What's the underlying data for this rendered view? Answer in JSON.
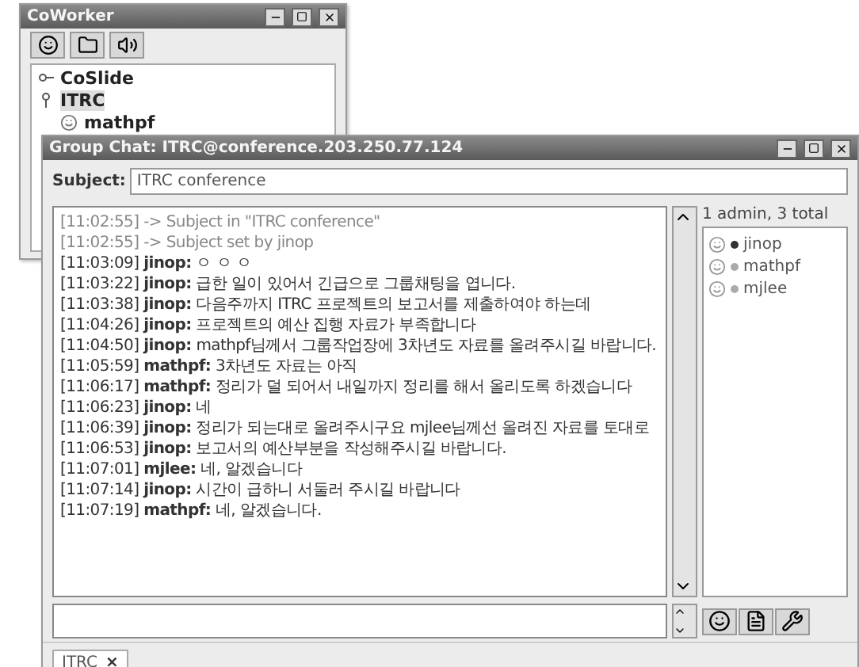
{
  "back_window": {
    "title": "CoWorker",
    "tree": [
      {
        "label": "CoSlide",
        "expanded": false,
        "selected": false
      },
      {
        "label": "ITRC",
        "expanded": true,
        "selected": true,
        "children": [
          {
            "label": "mathpf",
            "selected": false
          }
        ]
      }
    ]
  },
  "chat_window": {
    "title": "Group Chat: ITRC@conference.203.250.77.124",
    "subject_label": "Subject:",
    "subject": "ITRC conference",
    "messages": [
      {
        "kind": "system",
        "time": "[11:02:55]",
        "text": "-> Subject in \"ITRC conference\""
      },
      {
        "kind": "system",
        "time": "[11:02:55]",
        "text": "-> Subject set by jinop"
      },
      {
        "kind": "message",
        "time": "[11:03:09]",
        "sender": "jinop:",
        "text": "ㅇ ㅇ ㅇ"
      },
      {
        "kind": "message",
        "time": "[11:03:22]",
        "sender": "jinop:",
        "text": "급한 일이 있어서 긴급으로 그룹채팅을 엽니다."
      },
      {
        "kind": "message",
        "time": "[11:03:38]",
        "sender": "jinop:",
        "text": "다음주까지 ITRC 프로젝트의 보고서를 제출하여야 하는데"
      },
      {
        "kind": "message",
        "time": "[11:04:26]",
        "sender": "jinop:",
        "text": "프로젝트의 예산 집행 자료가 부족합니다"
      },
      {
        "kind": "message",
        "time": "[11:04:50]",
        "sender": "jinop:",
        "text": "mathpf님께서 그룹작업장에 3차년도 자료를 올려주시길 바랍니다."
      },
      {
        "kind": "message",
        "time": "[11:05:59]",
        "sender": "mathpf:",
        "text": "3차년도 자료는 아직"
      },
      {
        "kind": "message",
        "time": "[11:06:17]",
        "sender": "mathpf:",
        "text": "정리가 덜 되어서 내일까지 정리를 해서 올리도록 하겠습니다"
      },
      {
        "kind": "message",
        "time": "[11:06:23]",
        "sender": "jinop:",
        "text": "네"
      },
      {
        "kind": "message",
        "time": "[11:06:39]",
        "sender": "jinop:",
        "text": "정리가 되는대로 올려주시구요 mjlee님께선 올려진 자료를 토대로"
      },
      {
        "kind": "message",
        "time": "[11:06:53]",
        "sender": "jinop:",
        "text": "보고서의 예산부분을 작성해주시길 바랍니다."
      },
      {
        "kind": "message",
        "time": "[11:07:01]",
        "sender": "mjlee:",
        "text": "네, 알겠습니다"
      },
      {
        "kind": "message",
        "time": "[11:07:14]",
        "sender": "jinop:",
        "text": "시간이 급하니 서둘러 주시길 바랍니다"
      },
      {
        "kind": "message",
        "time": "[11:07:19]",
        "sender": "mathpf:",
        "text": "네, 알겠습니다."
      }
    ],
    "occupants_summary": "1 admin, 3 total",
    "occupants": [
      {
        "name": "jinop",
        "admin": true
      },
      {
        "name": "mathpf",
        "admin": false
      },
      {
        "name": "mjlee",
        "admin": false
      }
    ]
  },
  "tabs": [
    {
      "label": "ITRC",
      "selected": true,
      "close": "×"
    }
  ]
}
